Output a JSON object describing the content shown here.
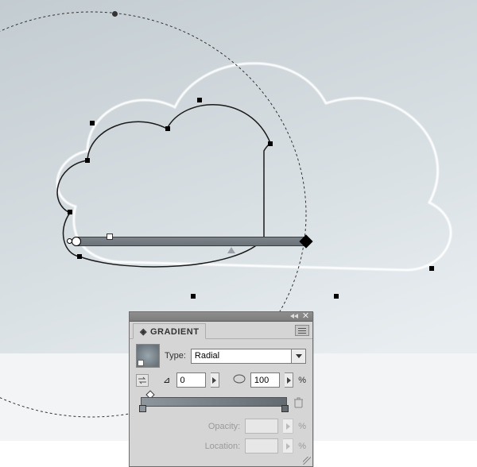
{
  "panel": {
    "title": "GRADIENT",
    "type_label": "Type:",
    "type_value": "Radial",
    "angle_value": "0",
    "aspect_value": "100",
    "percent": "%",
    "opacity_label": "Opacity:",
    "opacity_value": "",
    "location_label": "Location:",
    "location_value": ""
  },
  "icons": {
    "close": "✕",
    "trash": "🗑"
  }
}
